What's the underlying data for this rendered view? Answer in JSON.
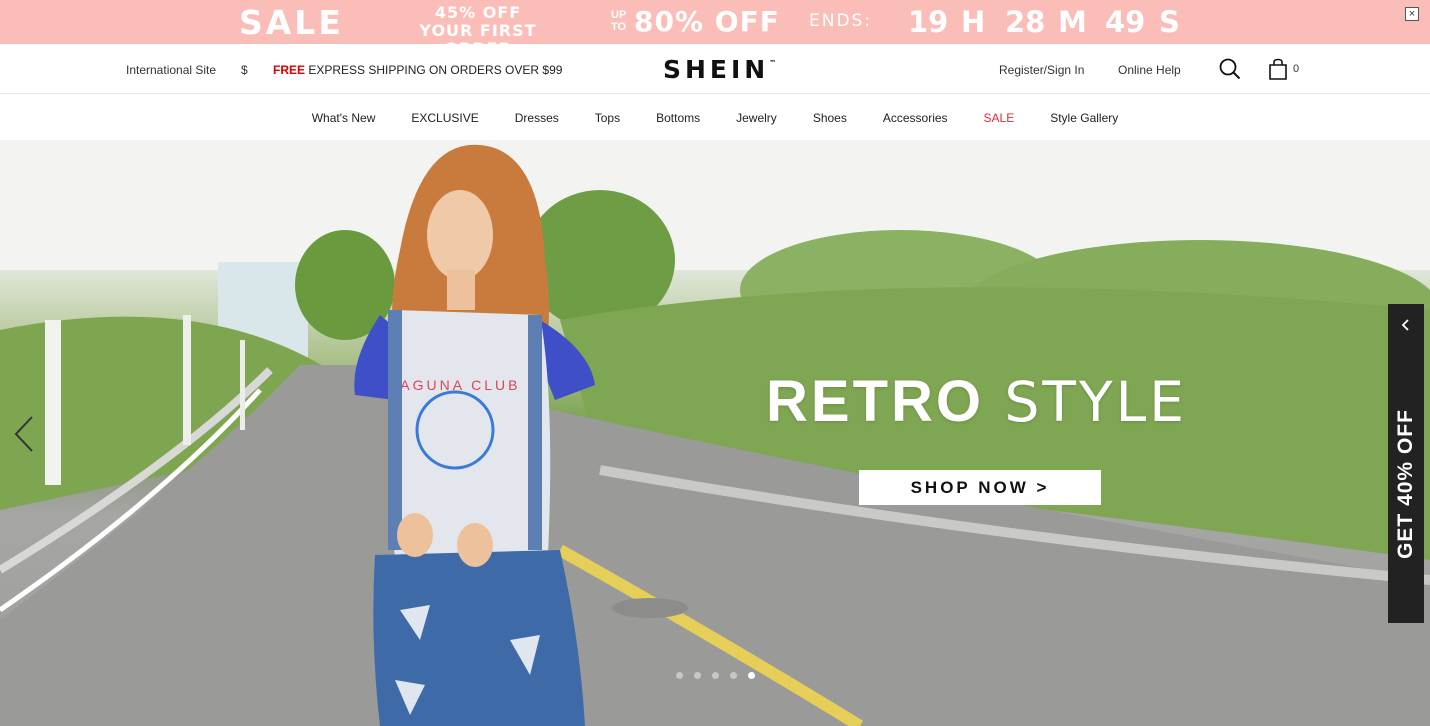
{
  "promo": {
    "sale": "SALE",
    "first_order_line1": "45% OFF",
    "first_order_line2": "YOUR FIRST ORDER",
    "upto": "UP TO",
    "discount": "80% OFF",
    "ends_label": "ENDS:",
    "countdown": {
      "hours": "19",
      "hours_unit": "H",
      "minutes": "28",
      "minutes_unit": "M",
      "seconds": "49",
      "seconds_unit": "S"
    },
    "close_label": "×"
  },
  "header": {
    "international": "International Site",
    "currency": "$",
    "shipping_free": "FREE",
    "shipping_text": " EXPRESS SHIPPING ON ORDERS OVER $99",
    "logo": "SHEIN",
    "logo_tm": "™",
    "register": "Register/Sign In",
    "help": "Online Help",
    "search_icon": "search-icon",
    "bag_icon": "shopping-bag-icon",
    "bag_count": "0"
  },
  "nav": {
    "items": [
      "What's New",
      "EXCLUSIVE",
      "Dresses",
      "Tops",
      "Bottoms",
      "Jewelry",
      "Shoes",
      "Accessories",
      "SALE",
      "Style Gallery"
    ]
  },
  "hero": {
    "headline_bold": "RETRO",
    "headline_light": " STYLE",
    "cta": "SHOP NOW >",
    "shirt_text": "LAGUNA CLUB",
    "slides": 5,
    "active_slide": 5
  },
  "sidetab": {
    "label": "GET 40% OFF"
  },
  "colors": {
    "promo_bg": "#fbbdb8",
    "sale_red": "#e02a3a",
    "free_red": "#d50000",
    "sidetab_bg": "#222222"
  }
}
